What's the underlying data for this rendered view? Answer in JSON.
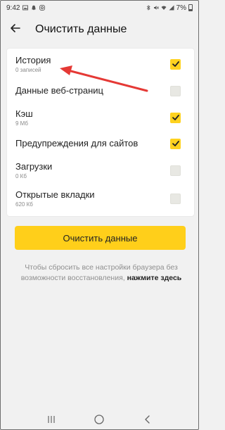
{
  "status_bar": {
    "time": "9:42",
    "battery_text": "7%"
  },
  "header": {
    "title": "Очистить данные",
    "back_icon": "arrow-left-icon"
  },
  "items": [
    {
      "label": "История",
      "sub": "0 записей",
      "checked": true
    },
    {
      "label": "Данные веб-страниц",
      "sub": "",
      "checked": false
    },
    {
      "label": "Кэш",
      "sub": "9 Мб",
      "checked": true
    },
    {
      "label": "Предупреждения для сайтов",
      "sub": "",
      "checked": true
    },
    {
      "label": "Загрузки",
      "sub": "0 Кб",
      "checked": false
    },
    {
      "label": "Открытые вкладки",
      "sub": "620 Кб",
      "checked": false
    }
  ],
  "clear_button_label": "Очистить данные",
  "note": {
    "text": "Чтобы сбросить все настройки браузера без возможности восстановления, ",
    "link": "нажмите здесь"
  },
  "colors": {
    "accent": "#ffcf1a",
    "checkbox_on": "#ffd21f",
    "checkbox_off": "#e8e8e3",
    "annotation_arrow": "#e53935"
  }
}
